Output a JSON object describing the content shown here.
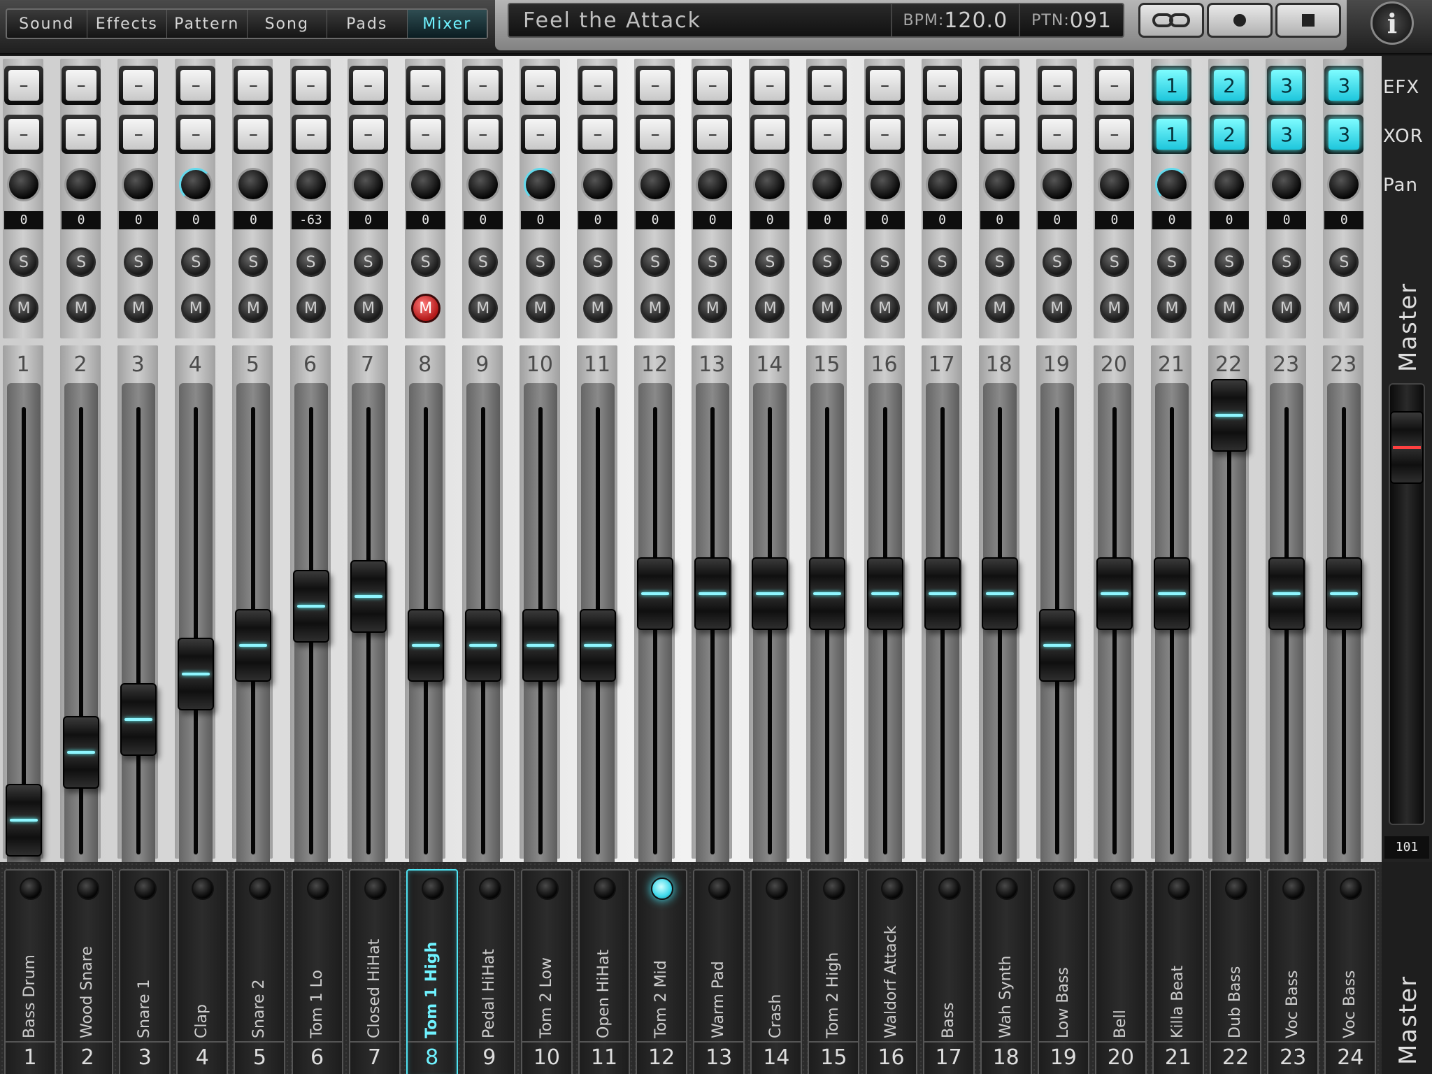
{
  "tabs": [
    {
      "label": "Sound",
      "active": false
    },
    {
      "label": "Effects",
      "active": false
    },
    {
      "label": "Pattern",
      "active": false
    },
    {
      "label": "Song",
      "active": false
    },
    {
      "label": "Pads",
      "active": false
    },
    {
      "label": "Mixer",
      "active": true
    }
  ],
  "song": {
    "title": "Feel the Attack",
    "bpm_label": "BPM:",
    "bpm_value": "120.0",
    "ptn_label": "PTN:",
    "ptn_value": "091"
  },
  "transport": {
    "link": "link-icon",
    "record": "record-icon",
    "stop": "stop-icon"
  },
  "info_label": "i",
  "row_labels": {
    "efx": "EFX",
    "xor": "XOR",
    "pan": "Pan"
  },
  "solo_label": "S",
  "mute_label": "M",
  "master": {
    "label": "Master",
    "value": "101",
    "pad_label": "Master"
  },
  "accent_color": "#5ff0ff",
  "mute_active_color": "#d63a3a",
  "channels": [
    {
      "num": "1",
      "efx": "–",
      "xor": "–",
      "pan": "0",
      "muted": false,
      "vol": "002",
      "pan_arc": false
    },
    {
      "num": "2",
      "efx": "–",
      "xor": "–",
      "pan": "0",
      "muted": false,
      "vol": "023",
      "pan_arc": false
    },
    {
      "num": "3",
      "efx": "–",
      "xor": "–",
      "pan": "0",
      "muted": false,
      "vol": "033",
      "pan_arc": false
    },
    {
      "num": "4",
      "efx": "–",
      "xor": "–",
      "pan": "0",
      "muted": false,
      "vol": "047",
      "pan_arc": true
    },
    {
      "num": "5",
      "efx": "–",
      "xor": "–",
      "pan": "0",
      "muted": false,
      "vol": "056",
      "pan_arc": false
    },
    {
      "num": "6",
      "efx": "–",
      "xor": "–",
      "pan": "-63",
      "muted": false,
      "vol": "068",
      "pan_arc": false
    },
    {
      "num": "7",
      "efx": "–",
      "xor": "–",
      "pan": "0",
      "muted": false,
      "vol": "071",
      "pan_arc": false
    },
    {
      "num": "8",
      "efx": "–",
      "xor": "–",
      "pan": "0",
      "muted": true,
      "vol": "056",
      "pan_arc": false
    },
    {
      "num": "9",
      "efx": "–",
      "xor": "–",
      "pan": "0",
      "muted": false,
      "vol": "056",
      "pan_arc": false
    },
    {
      "num": "10",
      "efx": "–",
      "xor": "–",
      "pan": "0",
      "muted": false,
      "vol": "056",
      "pan_arc": true
    },
    {
      "num": "11",
      "efx": "–",
      "xor": "–",
      "pan": "0",
      "muted": false,
      "vol": "056",
      "pan_arc": false
    },
    {
      "num": "12",
      "efx": "–",
      "xor": "–",
      "pan": "0",
      "muted": false,
      "vol": "072",
      "pan_arc": false
    },
    {
      "num": "13",
      "efx": "–",
      "xor": "–",
      "pan": "0",
      "muted": false,
      "vol": "072",
      "pan_arc": false
    },
    {
      "num": "14",
      "efx": "–",
      "xor": "–",
      "pan": "0",
      "muted": false,
      "vol": "072",
      "pan_arc": false
    },
    {
      "num": "15",
      "efx": "–",
      "xor": "–",
      "pan": "0",
      "muted": false,
      "vol": "072",
      "pan_arc": false
    },
    {
      "num": "16",
      "efx": "–",
      "xor": "–",
      "pan": "0",
      "muted": false,
      "vol": "072",
      "pan_arc": false
    },
    {
      "num": "17",
      "efx": "–",
      "xor": "–",
      "pan": "0",
      "muted": false,
      "vol": "072",
      "pan_arc": false
    },
    {
      "num": "18",
      "efx": "–",
      "xor": "–",
      "pan": "0",
      "muted": false,
      "vol": "072",
      "pan_arc": false
    },
    {
      "num": "19",
      "efx": "–",
      "xor": "–",
      "pan": "0",
      "muted": false,
      "vol": "056",
      "pan_arc": false
    },
    {
      "num": "20",
      "efx": "–",
      "xor": "–",
      "pan": "0",
      "muted": false,
      "vol": "072",
      "pan_arc": false
    },
    {
      "num": "21",
      "efx": "1",
      "xor": "1",
      "pan": "0",
      "muted": false,
      "vol": "072",
      "pan_arc": true
    },
    {
      "num": "22",
      "efx": "2",
      "xor": "2",
      "pan": "0",
      "muted": false,
      "vol": "127",
      "pan_arc": false
    },
    {
      "num": "23",
      "efx": "3",
      "xor": "3",
      "pan": "0",
      "muted": false,
      "vol": "072",
      "pan_arc": false
    },
    {
      "num": "23",
      "efx": "3",
      "xor": "3",
      "pan": "0",
      "muted": false,
      "vol": "072",
      "pan_arc": false
    }
  ],
  "pads": [
    {
      "name": "Bass Drum",
      "num": "1"
    },
    {
      "name": "Wood Snare",
      "num": "2"
    },
    {
      "name": "Snare 1",
      "num": "3"
    },
    {
      "name": "Clap",
      "num": "4"
    },
    {
      "name": "Snare 2",
      "num": "5"
    },
    {
      "name": "Tom 1 Lo",
      "num": "6"
    },
    {
      "name": "Closed HiHat",
      "num": "7"
    },
    {
      "name": "Tom 1 High",
      "num": "8",
      "selected": true
    },
    {
      "name": "Pedal HiHat",
      "num": "9"
    },
    {
      "name": "Tom 2 Low",
      "num": "10"
    },
    {
      "name": "Open HiHat",
      "num": "11"
    },
    {
      "name": "Tom 2 Mid",
      "num": "12",
      "lit": true
    },
    {
      "name": "Warm Pad",
      "num": "13"
    },
    {
      "name": "Crash",
      "num": "14"
    },
    {
      "name": "Tom 2 High",
      "num": "15"
    },
    {
      "name": "Waldorf Attack",
      "num": "16"
    },
    {
      "name": "Bass",
      "num": "17"
    },
    {
      "name": "Wah Synth",
      "num": "18"
    },
    {
      "name": "Low Bass",
      "num": "19"
    },
    {
      "name": "Bell",
      "num": "20"
    },
    {
      "name": "Killa Beat",
      "num": "21"
    },
    {
      "name": "Dub Bass",
      "num": "22"
    },
    {
      "name": "Voc Bass",
      "num": "23"
    },
    {
      "name": "Voc Bass",
      "num": "24"
    }
  ]
}
